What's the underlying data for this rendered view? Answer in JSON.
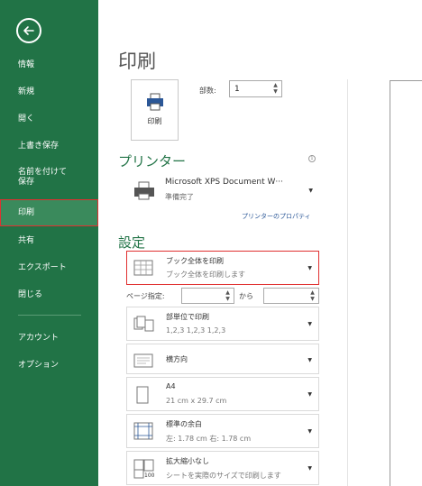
{
  "sidebar": {
    "items": [
      {
        "id": "info",
        "label": "情報"
      },
      {
        "id": "new",
        "label": "新規"
      },
      {
        "id": "open",
        "label": "開く"
      },
      {
        "id": "save",
        "label": "上書き保存"
      },
      {
        "id": "saveas",
        "label": "名前を付けて\n保存"
      },
      {
        "id": "print",
        "label": "印刷"
      },
      {
        "id": "share",
        "label": "共有"
      },
      {
        "id": "export",
        "label": "エクスポート"
      },
      {
        "id": "close",
        "label": "閉じる"
      },
      {
        "id": "account",
        "label": "アカウント"
      },
      {
        "id": "options",
        "label": "オプション"
      }
    ],
    "selected": "print"
  },
  "main": {
    "title": "印刷",
    "print_button": "印刷",
    "copies_label": "部数:",
    "copies_value": "1",
    "printer_section": "プリンター",
    "printer_name": "Microsoft XPS Document W···",
    "printer_status": "準備完了",
    "printer_properties": "プリンターのプロパティ",
    "settings_section": "設定",
    "settings": {
      "scope": {
        "title": "ブック全体を印刷",
        "sub": "ブック全体を印刷します"
      },
      "pages_label": "ページ指定:",
      "pages_to_label": "から",
      "collate": {
        "title": "部単位で印刷",
        "sub": "1,2,3    1,2,3    1,2,3"
      },
      "orientation": {
        "title": "横方向"
      },
      "paper": {
        "title": "A4",
        "sub": "21 cm x 29.7 cm"
      },
      "margins": {
        "title": "標準の余白",
        "sub": "左: 1.78 cm    右: 1.78 cm"
      },
      "scaling": {
        "title": "拡大縮小なし",
        "sub": "シートを実際のサイズで印刷します"
      }
    }
  },
  "colors": {
    "sidebar": "#217346",
    "accent": "#217346",
    "highlight": "#e03030"
  }
}
